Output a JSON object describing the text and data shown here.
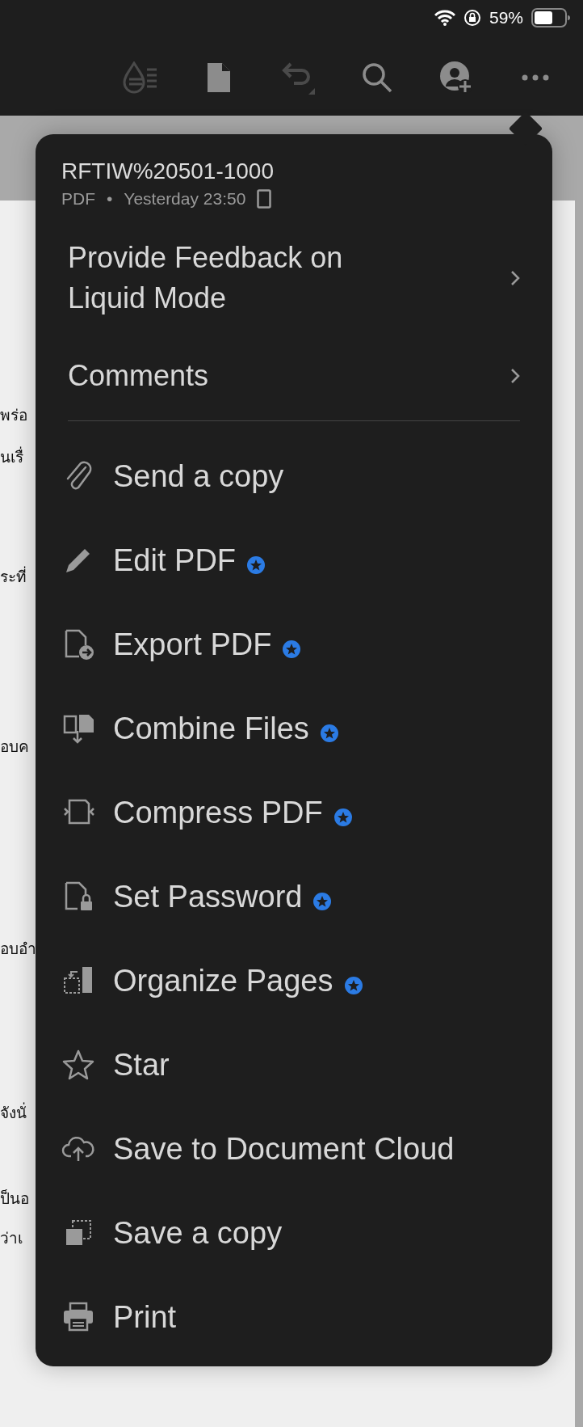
{
  "status_bar": {
    "battery_text": "59%"
  },
  "toolbar": [
    {
      "disabled": true
    },
    {
      "disabled": false
    },
    {
      "disabled": true
    },
    {
      "disabled": false
    },
    {
      "disabled": false
    },
    {
      "disabled": false
    }
  ],
  "document": {
    "lines": [
      "พร่อ",
      "นเรื่",
      "ระที่",
      "อบค",
      "อบอำ",
      "จังนั่",
      "ป็นอ",
      "ว่าเ"
    ]
  },
  "menu": {
    "title": "RFTIW%20501-1000",
    "file_type": "PDF",
    "separator": "•",
    "modified": "Yesterday 23:50",
    "submenus": [
      {
        "label": "Provide Feedback on Liquid Mode"
      },
      {
        "label": "Comments"
      }
    ],
    "items": [
      {
        "label": "Send a copy",
        "premium": false
      },
      {
        "label": "Edit PDF",
        "premium": true
      },
      {
        "label": "Export PDF",
        "premium": true
      },
      {
        "label": "Combine Files",
        "premium": true
      },
      {
        "label": "Compress PDF",
        "premium": true
      },
      {
        "label": "Set Password",
        "premium": true
      },
      {
        "label": "Organize Pages",
        "premium": true
      },
      {
        "label": "Star",
        "premium": false
      },
      {
        "label": "Save to Document Cloud",
        "premium": false
      },
      {
        "label": "Save a copy",
        "premium": false
      },
      {
        "label": "Print",
        "premium": false
      }
    ]
  }
}
